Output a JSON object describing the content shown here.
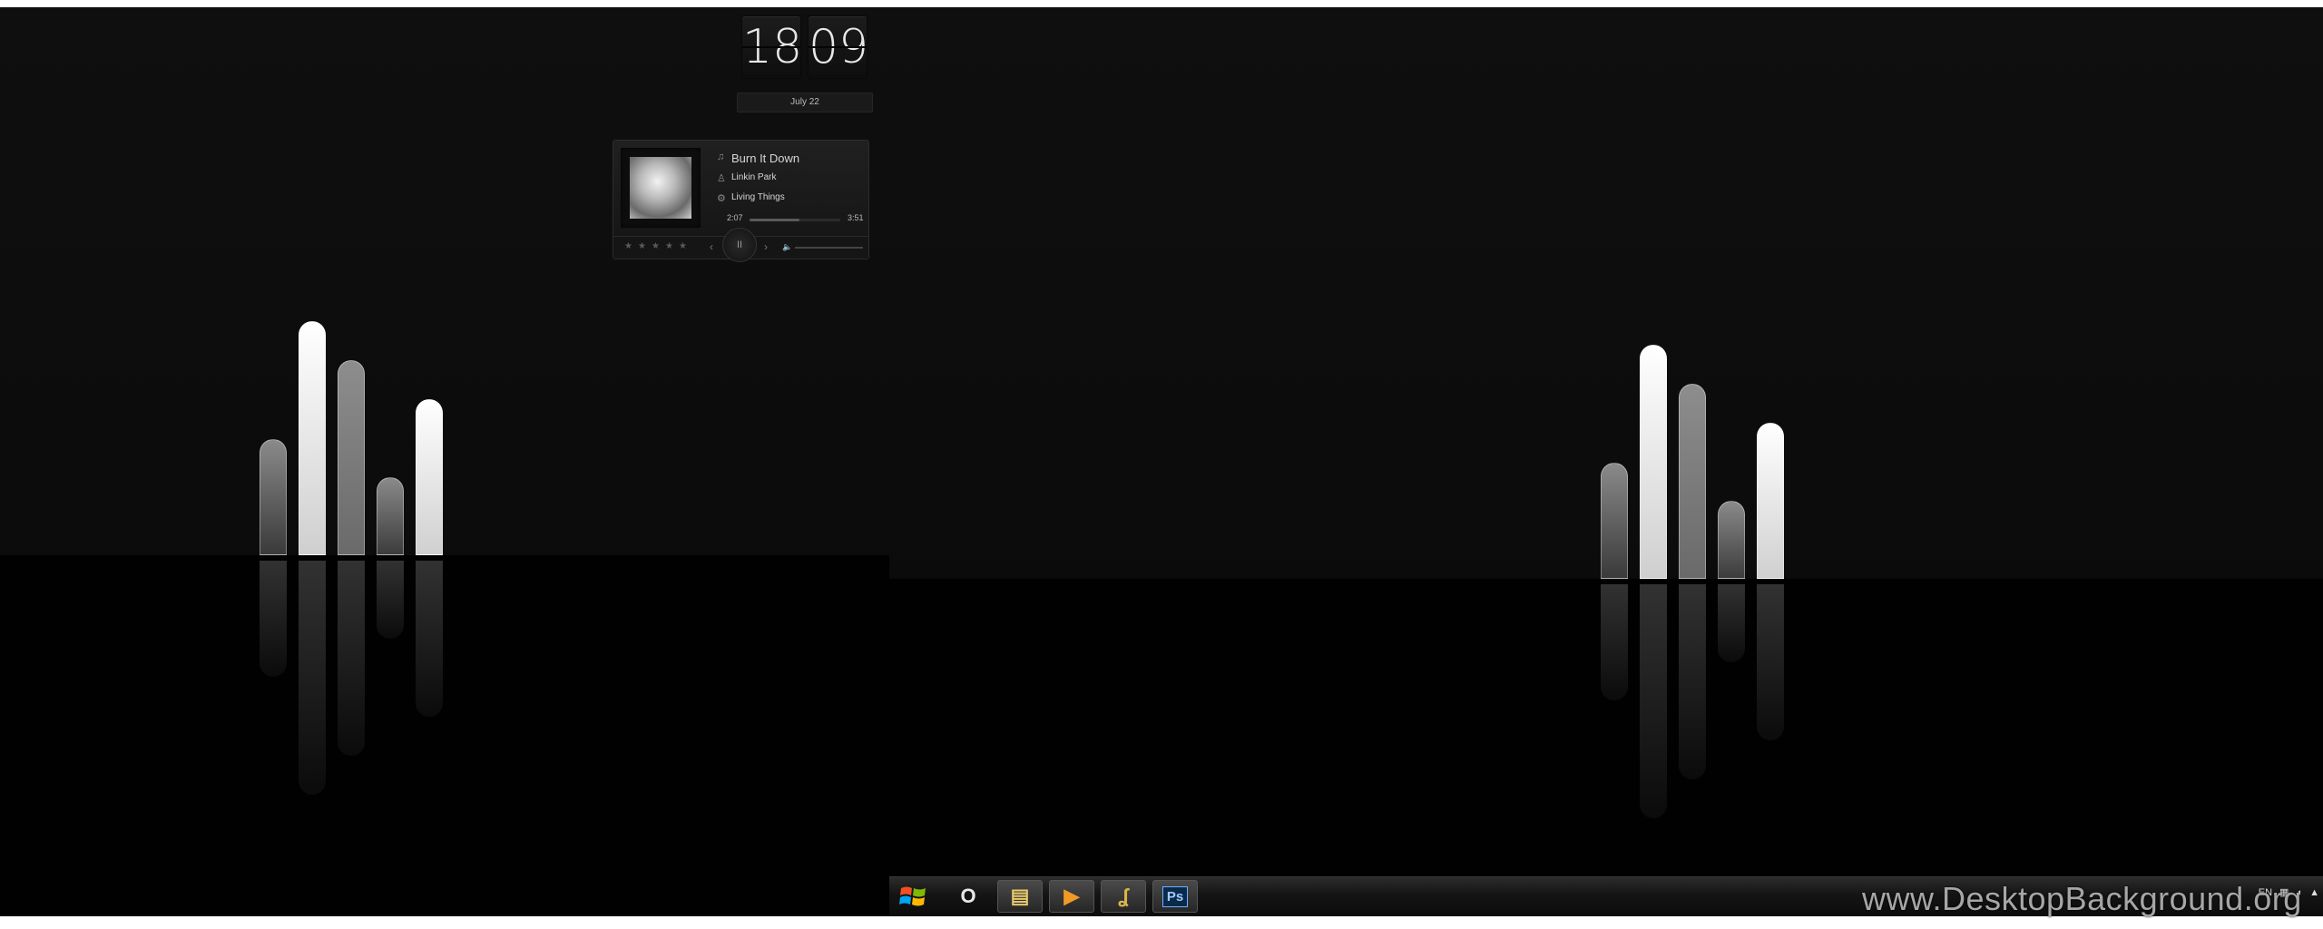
{
  "clock": {
    "hours": "18",
    "minutes": "09",
    "date": "July  22"
  },
  "player": {
    "title": "Burn It Down",
    "artist": "Linkin Park",
    "album": "Living Things",
    "elapsed": "2:07",
    "duration": "3:51",
    "progress": 0.55,
    "rating_stars": 5,
    "rating_value": 0,
    "icons": {
      "title": "music-note-icon",
      "artist": "person-icon",
      "album": "disc-icon",
      "play": "pause-icon",
      "prev": "chevron-left-icon",
      "next": "chevron-right-icon",
      "volume": "speaker-icon"
    },
    "glyphs": {
      "note": "♫",
      "person": "♙",
      "disc": "⚙",
      "pause": "II",
      "prev": "‹",
      "next": "›",
      "speaker": "🔈",
      "star": "★"
    }
  },
  "taskbar": {
    "start_icon": "windows-start-icon",
    "apps": [
      {
        "name": "opera-icon",
        "glyph": "O",
        "color": "#e9e9e9"
      },
      {
        "name": "file-explorer-icon",
        "glyph": "▤",
        "color": "#e8c96b"
      },
      {
        "name": "media-player-icon",
        "glyph": "▶",
        "color": "#f29a26"
      },
      {
        "name": "audition-icon",
        "glyph": "ʆ",
        "color": "#d8b64a"
      },
      {
        "name": "photoshop-icon",
        "glyph": "Ps",
        "color": "#9ecbff"
      }
    ],
    "tray_lang": "EN",
    "tray_icons": [
      "network-icon",
      "speaker-icon",
      "notifications-icon"
    ]
  },
  "watermark": "www.DesktopBackground.org",
  "colors": {
    "wallpaper": "#0c0c0c",
    "floor": "#010101",
    "bar_white": "#f5f5f5",
    "bar_gray": "#7a7a7a"
  }
}
